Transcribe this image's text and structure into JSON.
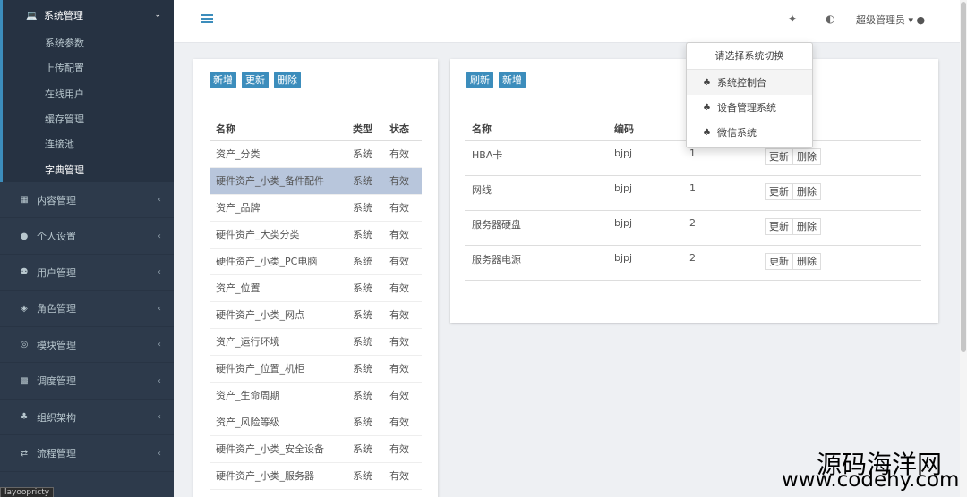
{
  "sidebar": {
    "top": {
      "label": "系统管理",
      "icon": "laptop-icon",
      "arrow": "⌄"
    },
    "subs": [
      "系统参数",
      "上传配置",
      "在线用户",
      "缓存管理",
      "连接池",
      "字典管理"
    ],
    "items": [
      {
        "label": "内容管理",
        "icon": "table-icon"
      },
      {
        "label": "个人设置",
        "icon": "user-icon"
      },
      {
        "label": "用户管理",
        "icon": "users-icon"
      },
      {
        "label": "角色管理",
        "icon": "eye-slash-icon"
      },
      {
        "label": "模块管理",
        "icon": "cube-icon"
      },
      {
        "label": "调度管理",
        "icon": "grid-icon"
      },
      {
        "label": "组织架构",
        "icon": "sitemap-icon"
      },
      {
        "label": "流程管理",
        "icon": "exchange-icon"
      }
    ],
    "arrow": "‹"
  },
  "topbar": {
    "user": "超级管理员"
  },
  "left_panel": {
    "buttons": [
      "新增",
      "更新",
      "删除"
    ],
    "headers": [
      "名称",
      "类型",
      "状态"
    ],
    "rows": [
      [
        "资产_分类",
        "系统",
        "有效"
      ],
      [
        "硬件资产_小类_备件配件",
        "系统",
        "有效"
      ],
      [
        "资产_品牌",
        "系统",
        "有效"
      ],
      [
        "硬件资产_大类分类",
        "系统",
        "有效"
      ],
      [
        "硬件资产_小类_PC电脑",
        "系统",
        "有效"
      ],
      [
        "资产_位置",
        "系统",
        "有效"
      ],
      [
        "硬件资产_小类_网点",
        "系统",
        "有效"
      ],
      [
        "资产_运行环境",
        "系统",
        "有效"
      ],
      [
        "硬件资产_位置_机柜",
        "系统",
        "有效"
      ],
      [
        "资产_生命周期",
        "系统",
        "有效"
      ],
      [
        "资产_风险等级",
        "系统",
        "有效"
      ],
      [
        "硬件资产_小类_安全设备",
        "系统",
        "有效"
      ],
      [
        "硬件资产_小类_服务器",
        "系统",
        "有效"
      ]
    ]
  },
  "right_panel": {
    "buttons": [
      "刷新",
      "新增"
    ],
    "headers": [
      "名称",
      "编码",
      "",
      ""
    ],
    "row_buttons": [
      "更新",
      "删除"
    ],
    "rows": [
      [
        "HBA卡",
        "bjpj",
        "1"
      ],
      [
        "网线",
        "bjpj",
        "1"
      ],
      [
        "服务器硬盘",
        "bjpj",
        "2"
      ],
      [
        "服务器电源",
        "bjpj",
        "2"
      ]
    ]
  },
  "dropdown": {
    "title": "请选择系统切换",
    "items": [
      "系统控制台",
      "设备管理系统",
      "微信系统"
    ]
  },
  "watermark": {
    "line1": "源码海洋网",
    "line2": "www.codehy.com"
  },
  "tooltip": "layoopricty",
  "colors": {
    "sidebar_bg": "#2d3a4b",
    "accent": "#3c8dbc",
    "selected_row": "#b8c6dc"
  }
}
